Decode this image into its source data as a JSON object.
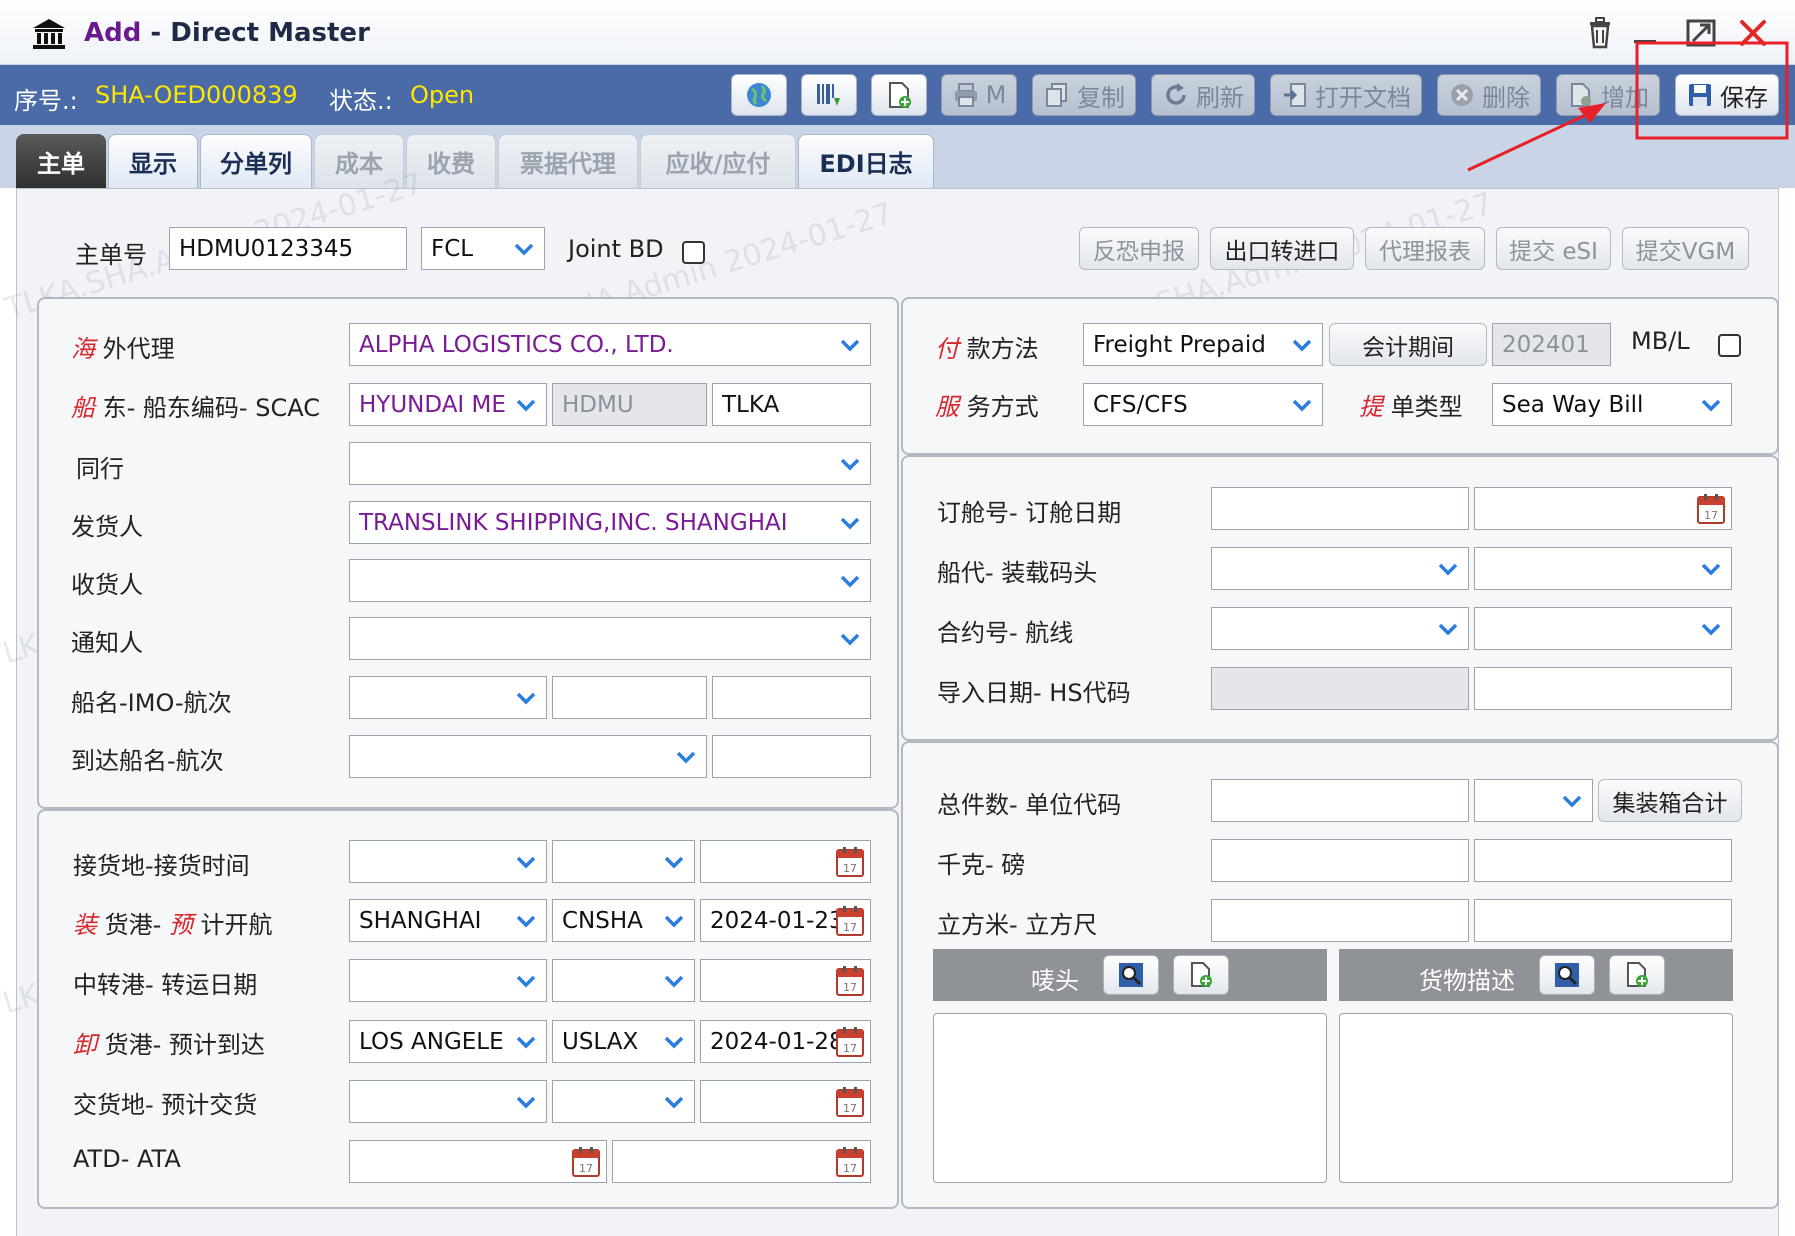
{
  "window": {
    "title_prefix": "Add",
    "title_sep": " - ",
    "title_main": "Direct Master"
  },
  "status": {
    "seq_label": "序号.:",
    "seq_value": "SHA-OED000839",
    "state_label": "状态.:",
    "state_value": "Open"
  },
  "toolbar": {
    "print_label": "M",
    "copy_label": "复制",
    "refresh_label": "刷新",
    "open_doc_label": "打开文档",
    "delete_label": "删除",
    "add_label": "增加",
    "save_label": "保存"
  },
  "tabs": [
    {
      "label": "主单"
    },
    {
      "label": "显示"
    },
    {
      "label": "分单列"
    },
    {
      "label": "成本"
    },
    {
      "label": "收费"
    },
    {
      "label": "票据代理"
    },
    {
      "label": "应收/应付"
    },
    {
      "label": "EDI日志"
    }
  ],
  "top": {
    "mbl_label": "主单号",
    "mbl_value": "HDMU0123345",
    "load_type": "FCL",
    "joint_bd_label": "Joint BD",
    "btn_antiterror": "反恐申报",
    "btn_export_to_import": "出口转进口",
    "btn_agent_report": "代理报表",
    "btn_submit_esi": "提交 eSI",
    "btn_submit_vgm": "提交VGM"
  },
  "left_upper": {
    "overseas_agent_em": "海",
    "overseas_agent_rest": " 外代理",
    "overseas_agent_value": "ALPHA LOGISTICS CO., LTD.",
    "carrier_em": "船",
    "carrier_rest": " 东- 船东编码- SCAC",
    "carrier_name": "HYUNDAI ME",
    "carrier_code": "HDMU",
    "carrier_scac": "TLKA",
    "coloader_label": "同行",
    "coloader_value": "",
    "shipper_label": "发货人",
    "shipper_value": "TRANSLINK SHIPPING,INC. SHANGHAI",
    "consignee_label": "收货人",
    "consignee_value": "",
    "notify_label": "通知人",
    "notify_value": "",
    "vessel_label": "船名-IMO-航次",
    "arrival_vessel_label": "到达船名-航次"
  },
  "left_lower": {
    "receipt_label": "接货地-接货时间",
    "pol_em1": "装",
    "pol_mid": " 货港- ",
    "pol_em2": "预",
    "pol_rest": " 计开航",
    "pol_name": "SHANGHAI",
    "pol_code": "CNSHA",
    "etd": "2024-01-23",
    "transship_label": "中转港- 转运日期",
    "pod_em": "卸",
    "pod_rest": " 货港- 预计到达",
    "pod_name": "LOS ANGELE",
    "pod_code": "USLAX",
    "eta": "2024-01-28",
    "delivery_label": "交货地- 预计交货",
    "atd_ata_label": "ATD- ATA"
  },
  "right_upper": {
    "payment_em": "付",
    "payment_rest": " 款方法",
    "payment_value": "Freight Prepaid",
    "period_btn": "会计期间",
    "period_value": "202401",
    "mbl_label": "MB/L",
    "service_em": "服",
    "service_rest": " 务方式",
    "service_value": "CFS/CFS",
    "bl_type_em": "提",
    "bl_type_rest": " 单类型",
    "bl_type_value": "Sea Way Bill"
  },
  "right_mid": {
    "booking_label": "订舱号- 订舱日期",
    "agent_terminal_label": "船代- 装载码头",
    "contract_route_label": "合约号-  航线",
    "import_hs_label": "导入日期-  HS代码"
  },
  "right_lower": {
    "packages_label": "总件数- 单位代码",
    "container_total_btn": "集装箱合计",
    "kg_lb_label": "千克- 磅",
    "cbm_cft_label": "立方米- 立方尺",
    "marks_label": "唛头",
    "goods_desc_label": "货物描述"
  },
  "watermark": "TLKA.SHA.Admin 2024-01-27",
  "colors": {
    "status_bar": "#4a6aa8",
    "status_value": "#ffe600",
    "purple_text": "#7a1a96",
    "required_red": "#d9262c",
    "annotation_red": "#e8202a"
  }
}
